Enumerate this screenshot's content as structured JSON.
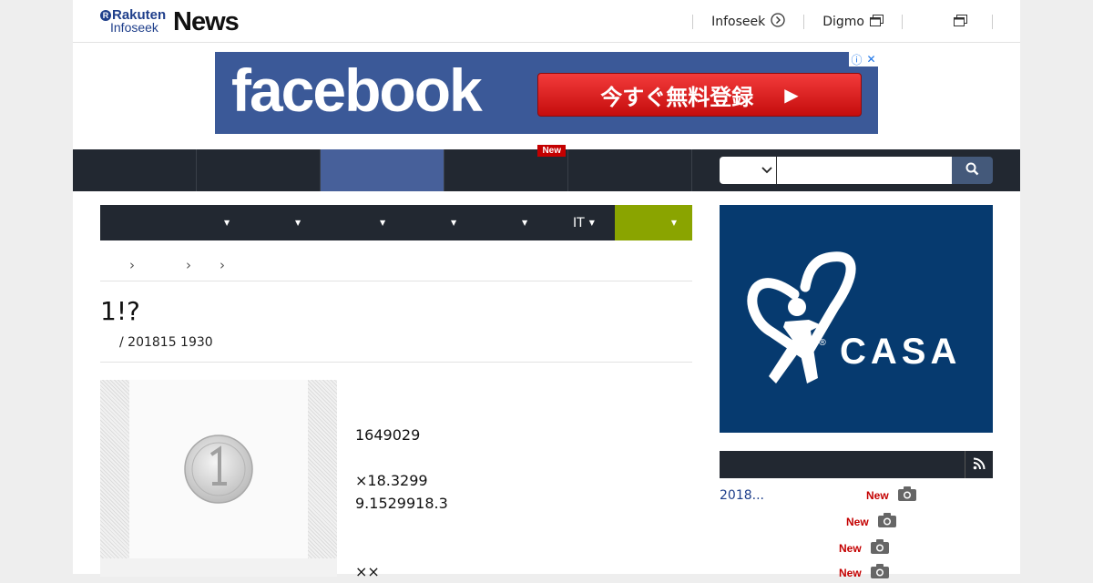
{
  "header": {
    "logo": {
      "brand": "Rakuten",
      "sub": "Infoseek",
      "news": "News"
    },
    "links": [
      {
        "label": "Infoseek",
        "icon": "circle-arrow-icon"
      },
      {
        "label": "Digmo",
        "icon": "window-icon"
      },
      {
        "label": "",
        "icon": "window-icon"
      }
    ]
  },
  "ad": {
    "brand": "facebook",
    "cta": "今すぐ無料登録",
    "cta_arrow": "▶"
  },
  "nav": {
    "new_tag": "New"
  },
  "categories": [
    {
      "label": ""
    },
    {
      "label": ""
    },
    {
      "label": ""
    },
    {
      "label": ""
    },
    {
      "label": ""
    },
    {
      "label": "IT"
    },
    {
      "label": ""
    }
  ],
  "article": {
    "title": "1!?",
    "meta": "/ 201815 1930",
    "body": [
      "1649029",
      "",
      "×18.3299",
      "9.1529918.3",
      "",
      "",
      "××"
    ]
  },
  "sidebar": {
    "ad_word": "CASA",
    "rows": [
      {
        "text": "2018...",
        "new": "New"
      },
      {
        "text": "",
        "new": "New"
      },
      {
        "text": "",
        "new": "New"
      },
      {
        "text": "",
        "new": "New"
      }
    ]
  },
  "colors": {
    "nav_bg": "#222831",
    "nav_active": "#47609a",
    "fb_blue": "#3b5998",
    "green_tab": "#8aa400",
    "new_red": "#c40000"
  }
}
